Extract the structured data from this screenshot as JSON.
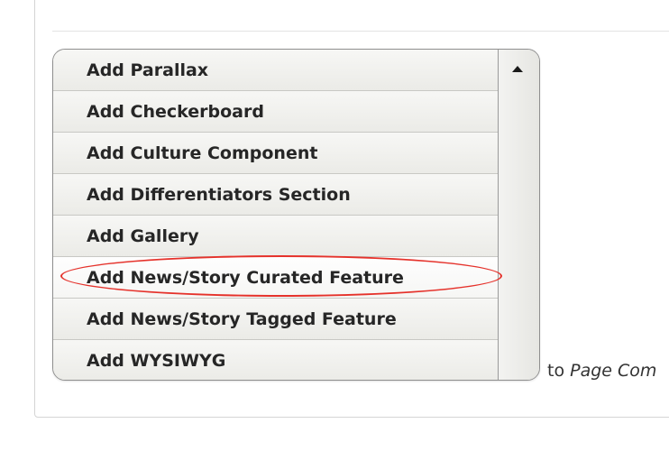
{
  "dropdown": {
    "items": [
      "Add Parallax",
      "Add Checkerboard",
      "Add Culture Component",
      "Add Differentiators Section",
      "Add Gallery",
      "Add News/Story Curated Feature",
      "Add News/Story Tagged Feature",
      "Add WYSIWYG"
    ],
    "highlighted_index": 5
  },
  "suffix": {
    "prefix": "to ",
    "target": "Page Com"
  },
  "colors": {
    "annotation": "#e5322b"
  }
}
